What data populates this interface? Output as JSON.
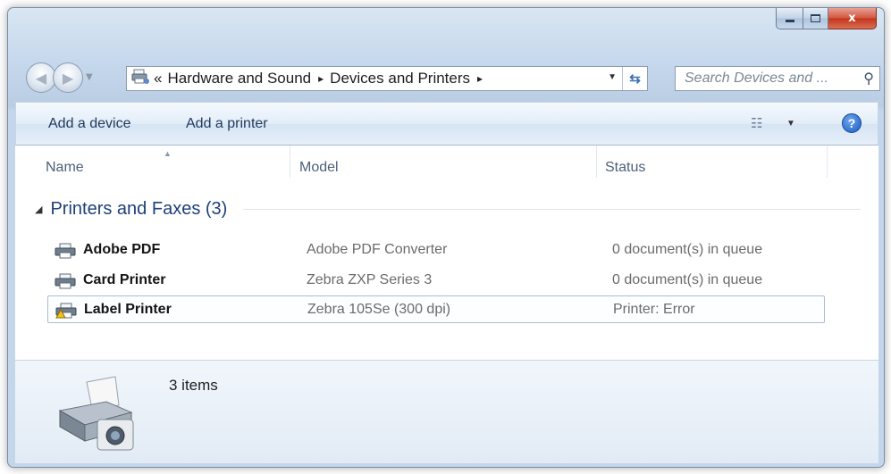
{
  "window": {
    "caption": {
      "minimize_icon": "minimize-icon",
      "maximize_icon": "maximize-icon",
      "close_label": "x"
    }
  },
  "nav": {
    "back_icon": "back-arrow-icon",
    "forward_icon": "forward-arrow-icon",
    "address": {
      "icon": "devices-and-printers-icon",
      "overflow": "«",
      "crumbs": [
        "Hardware and Sound",
        "Devices and Printers"
      ],
      "separator": "▸"
    },
    "search_placeholder": "Search Devices and ..."
  },
  "toolbar": {
    "add_device": "Add a device",
    "add_printer": "Add a printer"
  },
  "columns": {
    "name": "Name",
    "model": "Model",
    "status": "Status"
  },
  "group": {
    "title": "Printers and Faxes (3)"
  },
  "printers": [
    {
      "name": "Adobe PDF",
      "model": "Adobe PDF Converter",
      "status": "0 document(s) in queue",
      "selected": false,
      "warning": false
    },
    {
      "name": "Card Printer",
      "model": "Zebra ZXP Series 3",
      "status": "0 document(s) in queue",
      "selected": false,
      "warning": false
    },
    {
      "name": "Label Printer",
      "model": "Zebra 105Se (300 dpi)",
      "status": "Printer:  Error",
      "selected": true,
      "warning": true
    }
  ],
  "details": {
    "count": "3 items"
  },
  "colors": {
    "accent": "#1e3f7a",
    "toolbar_text": "#1e395b",
    "close_red": "#c2341c",
    "selection_border": "#a9bdd2"
  }
}
